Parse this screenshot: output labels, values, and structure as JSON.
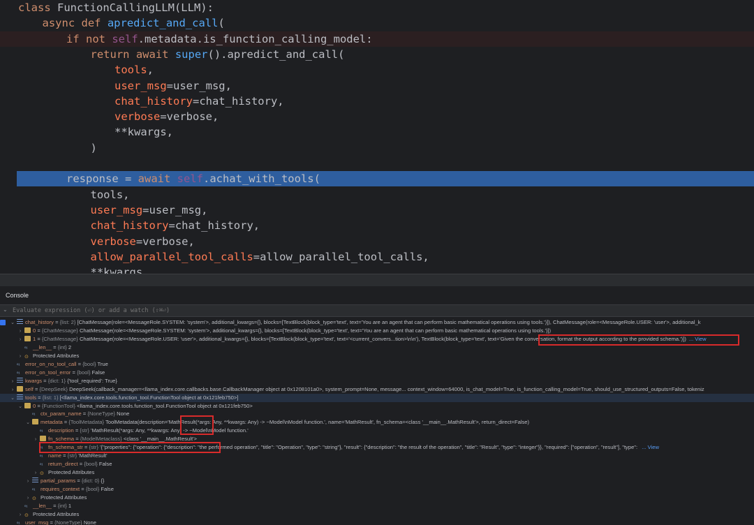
{
  "editor": {
    "lines": [
      {
        "indent": 0,
        "parts": [
          [
            "kw",
            "class "
          ],
          [
            "cls",
            "FunctionCallingLLM(LLM):"
          ]
        ]
      },
      {
        "indent": 1,
        "parts": [
          [
            "kw",
            "async def "
          ],
          [
            "fn",
            "apredict_and_call"
          ],
          [
            "cls",
            "("
          ]
        ]
      },
      {
        "indent": 2,
        "parts": [
          [
            "kw",
            "if not "
          ],
          [
            "self",
            "self"
          ],
          [
            "cls",
            ".metadata.is_function_calling_model:"
          ]
        ],
        "highlight": "red"
      },
      {
        "indent": 3,
        "parts": [
          [
            "kw",
            "return await "
          ],
          [
            "fn",
            "super"
          ],
          [
            "cls",
            "().apredict_and_call("
          ]
        ]
      },
      {
        "indent": 4,
        "parts": [
          [
            "param2",
            "tools"
          ],
          [
            "cls",
            ","
          ]
        ]
      },
      {
        "indent": 4,
        "parts": [
          [
            "param2",
            "user_msg"
          ],
          [
            "cls",
            "=user_msg,"
          ]
        ]
      },
      {
        "indent": 4,
        "parts": [
          [
            "param2",
            "chat_history"
          ],
          [
            "cls",
            "=chat_history,"
          ]
        ]
      },
      {
        "indent": 4,
        "parts": [
          [
            "param2",
            "verbose"
          ],
          [
            "cls",
            "=verbose,"
          ]
        ]
      },
      {
        "indent": 4,
        "parts": [
          [
            "cls",
            "**kwargs,"
          ]
        ]
      },
      {
        "indent": 3,
        "parts": [
          [
            "cls",
            ")"
          ]
        ]
      },
      {
        "indent": 0,
        "parts": []
      },
      {
        "indent": 2,
        "parts": [
          [
            "cls",
            "response = "
          ],
          [
            "kw",
            "await "
          ],
          [
            "self",
            "self"
          ],
          [
            "cls",
            ".achat_with_tools("
          ]
        ],
        "highlight": "blue"
      },
      {
        "indent": 3,
        "parts": [
          [
            "cls",
            "tools,"
          ]
        ]
      },
      {
        "indent": 3,
        "parts": [
          [
            "param2",
            "user_msg"
          ],
          [
            "cls",
            "=user_msg,"
          ]
        ]
      },
      {
        "indent": 3,
        "parts": [
          [
            "param2",
            "chat_history"
          ],
          [
            "cls",
            "=chat_history,"
          ]
        ]
      },
      {
        "indent": 3,
        "parts": [
          [
            "param2",
            "verbose"
          ],
          [
            "cls",
            "=verbose,"
          ]
        ]
      },
      {
        "indent": 3,
        "parts": [
          [
            "param2",
            "allow_parallel_tool_calls"
          ],
          [
            "cls",
            "=allow_parallel_tool_calls,"
          ]
        ]
      },
      {
        "indent": 3,
        "parts": [
          [
            "cls",
            "**kwargs"
          ]
        ]
      }
    ]
  },
  "console": {
    "title": "Console",
    "eval_placeholder": "Evaluate expression (⏎) or add a watch (⇧⌘⏎)"
  },
  "variables": [
    {
      "depth": 0,
      "toggle": "v",
      "icon": "list",
      "name": "chat_history",
      "type": "{list: 2}",
      "value": "[ChatMessage(role=<MessageRole.SYSTEM: 'system'>, additional_kwargs={}, blocks=[TextBlock(block_type='text', text='You are an agent that can perform basic mathematical operations using tools.')]), ChatMessage(role=<MessageRole.USER: 'user'>, additional_k"
    },
    {
      "depth": 1,
      "toggle": ">",
      "icon": "obj",
      "name": "0",
      "type": "{ChatMessage}",
      "value": "ChatMessage(role=<MessageRole.SYSTEM: 'system'>, additional_kwargs={}, blocks=[TextBlock(block_type='text', text='You are an agent that can perform basic mathematical operations using tools.')])"
    },
    {
      "depth": 1,
      "toggle": ">",
      "icon": "obj",
      "name": "1",
      "type": "{ChatMessage}",
      "value": "ChatMessage(role=<MessageRole.USER: 'user'>, additional_kwargs={}, blocks=[TextBlock(block_type='text', text='<current_convers...tion>\\n\\n'), TextBlock(block_type='text', text='Given the conversation, format the output according to the provided schema.')])",
      "link": "... View"
    },
    {
      "depth": 1,
      "toggle": "",
      "icon": "prim",
      "name": "__len__",
      "type": "{int}",
      "value": "2"
    },
    {
      "depth": 1,
      "toggle": ">",
      "icon": "prot",
      "name": "Protected Attributes",
      "type": "",
      "value": "",
      "plain": true
    },
    {
      "depth": 0,
      "toggle": "",
      "icon": "prim",
      "name": "error_on_no_tool_call",
      "type": "{bool}",
      "value": "True"
    },
    {
      "depth": 0,
      "toggle": "",
      "icon": "prim",
      "name": "error_on_tool_error",
      "type": "{bool}",
      "value": "False"
    },
    {
      "depth": 0,
      "toggle": ">",
      "icon": "list",
      "name": "kwargs",
      "type": "{dict: 1}",
      "value": "{'tool_required': True}"
    },
    {
      "depth": 0,
      "toggle": ">",
      "icon": "obj",
      "name": "self",
      "type": "{DeepSeek}",
      "value": "DeepSeek(callback_manager=<llama_index.core.callbacks.base.CallbackManager object at 0x1208101a0>, system_prompt=None, message... context_window=64000, is_chat_model=True, is_function_calling_model=True, should_use_structured_outputs=False, tokeniz"
    },
    {
      "depth": 0,
      "toggle": "v",
      "icon": "list",
      "name": "tools",
      "type": "{list: 1}",
      "value": "[<llama_index.core.tools.function_tool.FunctionTool object at 0x121feb750>]",
      "selected": true
    },
    {
      "depth": 1,
      "toggle": "v",
      "icon": "obj",
      "name": "0",
      "type": "{FunctionTool}",
      "value": "<llama_index.core.tools.function_tool.FunctionTool object at 0x121feb750>"
    },
    {
      "depth": 2,
      "toggle": "",
      "icon": "prim",
      "name": "ctx_param_name",
      "type": "{NoneType}",
      "value": "None"
    },
    {
      "depth": 2,
      "toggle": "v",
      "icon": "obj",
      "name": "metadata",
      "type": "{ToolMetadata}",
      "value": "ToolMetadata(description='MathResult(*args: Any, **kwargs: Any) -> ~Model\\nModel function.', name='MathResult', fn_schema=<class '__main__.MathResult'>, return_direct=False)"
    },
    {
      "depth": 3,
      "toggle": "",
      "icon": "prim",
      "name": "description",
      "type": "{str}",
      "value": "'MathResult(*args: Any, **kwargs: Any) -> ~Model\\nModel function.'"
    },
    {
      "depth": 3,
      "toggle": ">",
      "icon": "obj",
      "name": "fn_schema",
      "type": "{ModelMetaclass}",
      "value": "<class '__main__.MathResult'>"
    },
    {
      "depth": 3,
      "toggle": "",
      "icon": "prim",
      "name": "fn_schema_str",
      "type": "{str}",
      "value": "'{\"properties\": {\"operation\": {\"description\": \"the performed operation\", \"title\": \"Operation\", \"type\": \"string\"}, \"result\": {\"description\": \"the result of the operation\", \"title\": \"Result\", \"type\": \"integer\"}}, \"required\": [\"operation\", \"result\"], \"type\": ",
      "link": "... View"
    },
    {
      "depth": 3,
      "toggle": "",
      "icon": "prim",
      "name": "name",
      "type": "{str}",
      "value": "'MathResult'"
    },
    {
      "depth": 3,
      "toggle": "",
      "icon": "prim",
      "name": "return_direct",
      "type": "{bool}",
      "value": "False"
    },
    {
      "depth": 3,
      "toggle": ">",
      "icon": "prot",
      "name": "Protected Attributes",
      "type": "",
      "value": "",
      "plain": true
    },
    {
      "depth": 2,
      "toggle": ">",
      "icon": "list",
      "name": "partial_params",
      "type": "{dict: 0}",
      "value": "{}"
    },
    {
      "depth": 2,
      "toggle": "",
      "icon": "prim",
      "name": "requires_context",
      "type": "{bool}",
      "value": "False"
    },
    {
      "depth": 2,
      "toggle": ">",
      "icon": "prot",
      "name": "Protected Attributes",
      "type": "",
      "value": "",
      "plain": true
    },
    {
      "depth": 1,
      "toggle": "",
      "icon": "prim",
      "name": "__len__",
      "type": "{int}",
      "value": "1"
    },
    {
      "depth": 1,
      "toggle": ">",
      "icon": "prot",
      "name": "Protected Attributes",
      "type": "",
      "value": "",
      "plain": true
    },
    {
      "depth": 0,
      "toggle": "",
      "icon": "prim",
      "name": "user_msg",
      "type": "{NoneType}",
      "value": "None"
    }
  ],
  "colors": {
    "highlight_box": "#d92b2b",
    "selection": "#2e5e9f"
  }
}
